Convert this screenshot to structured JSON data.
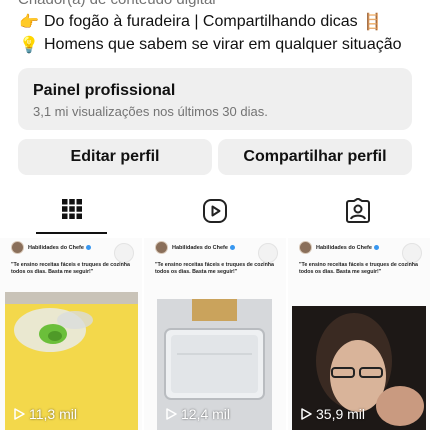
{
  "bio": {
    "category": "Criador(a) de conteúdo digital",
    "line1_emoji": "👉",
    "line1_text": "Do fogão à furadeira | Compartilhando dicas",
    "line1_trailing_emoji": "🪜",
    "line2_emoji": "💡",
    "line2_text": "Homens que sabem se virar em qualquer situação"
  },
  "dashboard": {
    "title": "Painel profissional",
    "subtitle": "3,1 mi visualizações nos últimos 30 dias."
  },
  "actions": {
    "edit_label": "Editar perfil",
    "share_label": "Compartilhar perfil"
  },
  "tabs": {
    "active": "grid",
    "icons": [
      "grid-icon",
      "reels-icon",
      "tagged-icon"
    ]
  },
  "posts": [
    {
      "author": "Habilidades do Chefe",
      "caption": "\"Te ensino receitas fáceis e truques de cozinha todos os dias. Basta me seguir!\"",
      "views": "11,3 mil"
    },
    {
      "author": "Habilidades do Chefe",
      "caption": "\"Te ensino receitas fáceis e truques de cozinha todos os dias. Basta me seguir!\"",
      "views": "12,4 mil"
    },
    {
      "author": "Habilidades do Chefe",
      "caption": "\"Te ensino receitas fáceis e truques de cozinha todos os dias. Basta me seguir!\"",
      "views": "35,9 mil"
    }
  ],
  "colors": {
    "panel_bg": "#efefef",
    "secondary_text": "#737373",
    "verified": "#3897f0"
  }
}
